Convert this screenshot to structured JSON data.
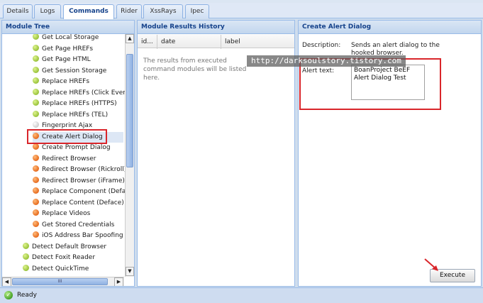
{
  "tabs": [
    "Details",
    "Logs",
    "Commands",
    "Rider",
    "XssRays",
    "Ipec"
  ],
  "active_tab": "Commands",
  "module_tree": {
    "title": "Module Tree",
    "items": [
      {
        "label": "Get Local Storage",
        "status": "green",
        "level": 2
      },
      {
        "label": "Get Page HREFs",
        "status": "green",
        "level": 2
      },
      {
        "label": "Get Page HTML",
        "status": "green",
        "level": 2
      },
      {
        "label": "Get Session Storage",
        "status": "green",
        "level": 2
      },
      {
        "label": "Replace HREFs",
        "status": "green",
        "level": 2
      },
      {
        "label": "Replace HREFs (Click Events",
        "status": "green",
        "level": 2
      },
      {
        "label": "Replace HREFs (HTTPS)",
        "status": "green",
        "level": 2
      },
      {
        "label": "Replace HREFs (TEL)",
        "status": "green",
        "level": 2
      },
      {
        "label": "Fingerprint Ajax",
        "status": "grey",
        "level": 2
      },
      {
        "label": "Create Alert Dialog",
        "status": "orange",
        "level": 2,
        "selected": true
      },
      {
        "label": "Create Prompt Dialog",
        "status": "orange",
        "level": 2
      },
      {
        "label": "Redirect Browser",
        "status": "orange",
        "level": 2
      },
      {
        "label": "Redirect Browser (Rickroll)",
        "status": "orange",
        "level": 2
      },
      {
        "label": "Redirect Browser (iFrame)",
        "status": "orange",
        "level": 2
      },
      {
        "label": "Replace Component (Deface",
        "status": "orange",
        "level": 2
      },
      {
        "label": "Replace Content (Deface)",
        "status": "orange",
        "level": 2
      },
      {
        "label": "Replace Videos",
        "status": "orange",
        "level": 2
      },
      {
        "label": "Get Stored Credentials",
        "status": "orange",
        "level": 2
      },
      {
        "label": "iOS Address Bar Spoofing",
        "status": "orange",
        "level": 2
      },
      {
        "label": "Detect Default Browser",
        "status": "green",
        "level": 1
      },
      {
        "label": "Detect Foxit Reader",
        "status": "green",
        "level": 1
      },
      {
        "label": "Detect QuickTime",
        "status": "green",
        "level": 1
      }
    ]
  },
  "results": {
    "title": "Module Results History",
    "columns": [
      "id...",
      "date",
      "label"
    ],
    "empty_message": "The results from executed command modules will be listed here."
  },
  "alert_dialog": {
    "title": "Create Alert Dialog",
    "description_label": "Description:",
    "description": "Sends an alert dialog to the hooked browser.",
    "alert_text_label": "Alert text:",
    "alert_text_value": "BoanProject BeEF Alert Dialog Test",
    "execute_label": "Execute"
  },
  "watermark": "http://darksoulstory.tistory.com",
  "status": {
    "text": "Ready"
  },
  "colors": {
    "highlight": "#d9262b",
    "header_text": "#15428b",
    "panel_border": "#99bbe8"
  }
}
